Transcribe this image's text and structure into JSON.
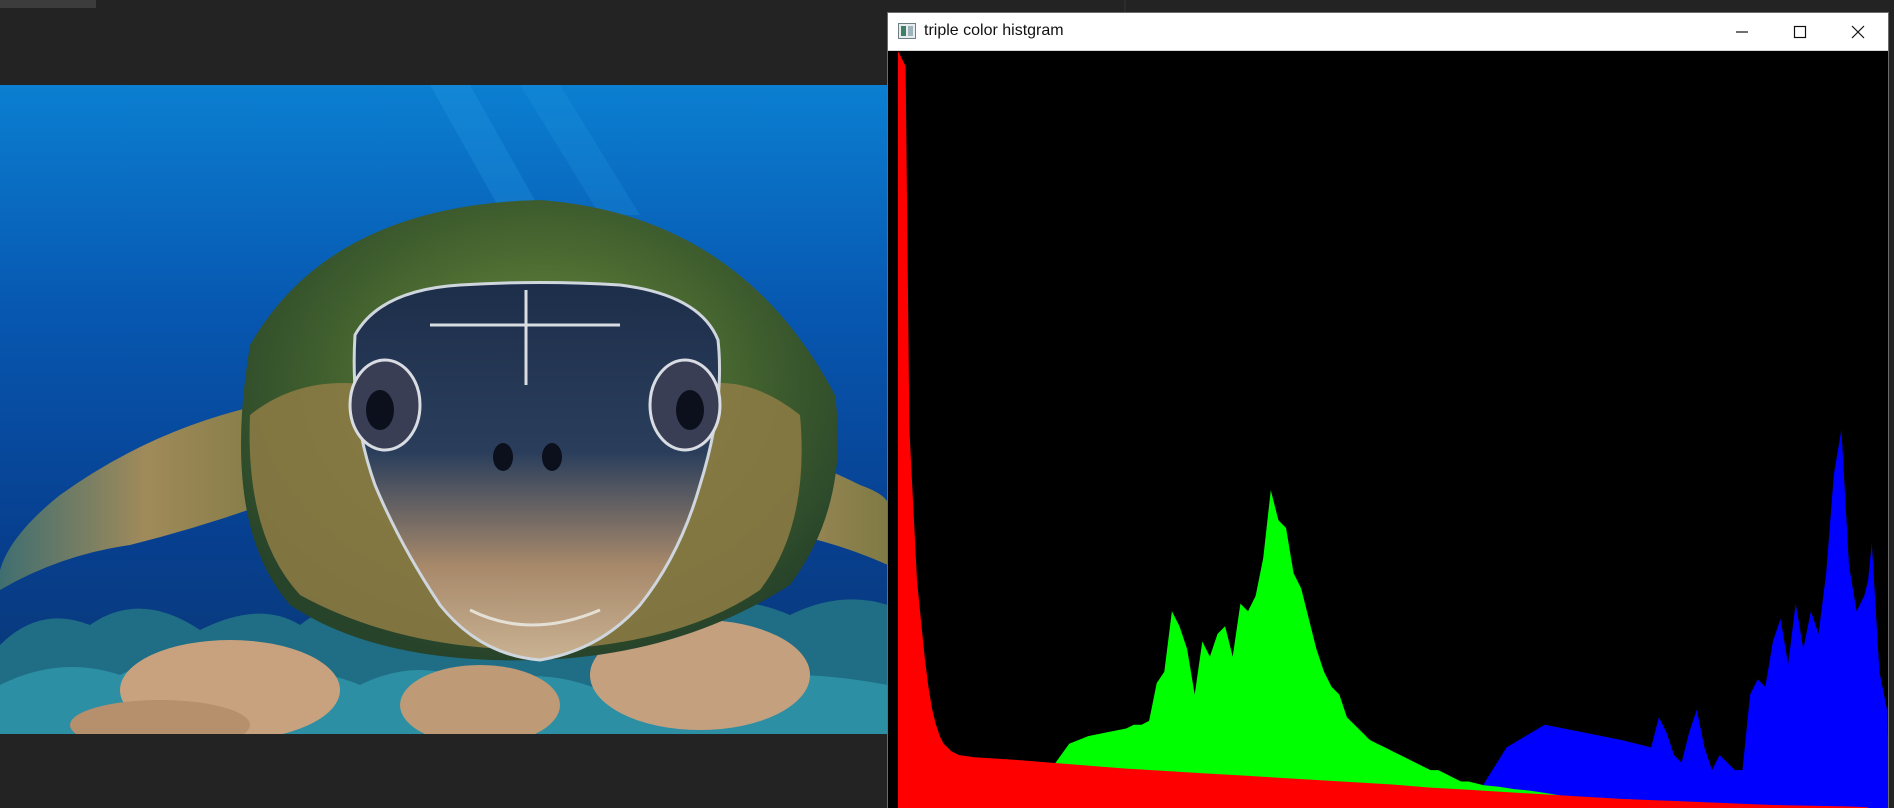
{
  "window": {
    "title": "triple color histgram",
    "icon": "image-window-icon",
    "buttons": [
      "minimize-icon",
      "maximize-icon",
      "close-icon"
    ]
  },
  "photo": {
    "subject": "sea turtle swimming over coral reef",
    "colors": {
      "water_top": "#0b7fd1",
      "water_deep": "#05357e",
      "coral": "#c8a27e"
    }
  },
  "colors": {
    "background": "#232323",
    "red_channel": "#ff0000",
    "green_channel": "#00ff00",
    "blue_channel": "#0000ff",
    "hist_background": "#000000"
  },
  "chart_data": {
    "type": "area",
    "title": "",
    "xlabel": "",
    "ylabel": "",
    "xlim": [
      0,
      255
    ],
    "ylim": [
      0,
      1
    ],
    "grid": false,
    "draw_order": [
      "blue",
      "green",
      "red"
    ],
    "series": [
      {
        "name": "",
        "channel": "blue",
        "color": "#0000ff",
        "points": [
          [
            0,
            0
          ],
          [
            150,
            0
          ],
          [
            160,
            0.08
          ],
          [
            170,
            0.11
          ],
          [
            180,
            0.1
          ],
          [
            190,
            0.09
          ],
          [
            198,
            0.08
          ],
          [
            200,
            0.12
          ],
          [
            202,
            0.1
          ],
          [
            204,
            0.07
          ],
          [
            206,
            0.06
          ],
          [
            208,
            0.1
          ],
          [
            210,
            0.13
          ],
          [
            212,
            0.08
          ],
          [
            214,
            0.05
          ],
          [
            216,
            0.07
          ],
          [
            218,
            0.06
          ],
          [
            220,
            0.05
          ],
          [
            222,
            0.05
          ],
          [
            224,
            0.15
          ],
          [
            226,
            0.17
          ],
          [
            228,
            0.16
          ],
          [
            230,
            0.22
          ],
          [
            232,
            0.25
          ],
          [
            234,
            0.19
          ],
          [
            236,
            0.27
          ],
          [
            238,
            0.21
          ],
          [
            240,
            0.26
          ],
          [
            242,
            0.23
          ],
          [
            244,
            0.31
          ],
          [
            246,
            0.44
          ],
          [
            248,
            0.5
          ],
          [
            250,
            0.32
          ],
          [
            252,
            0.26
          ],
          [
            254,
            0.28
          ],
          [
            255,
            0.3
          ],
          [
            256,
            0.35
          ],
          [
            258,
            0.18
          ],
          [
            260,
            0.13
          ],
          [
            262,
            0.09
          ],
          [
            264,
            0.06
          ],
          [
            266,
            0.05
          ],
          [
            268,
            0.04
          ],
          [
            270,
            0.035
          ],
          [
            272,
            0.025
          ],
          [
            274,
            0.02
          ],
          [
            276,
            0.016
          ],
          [
            278,
            0.014
          ],
          [
            280,
            0.012
          ],
          [
            282,
            0.01
          ],
          [
            284,
            0.009
          ],
          [
            286,
            0.006
          ],
          [
            290,
            0.004
          ],
          [
            300,
            0.002
          ],
          [
            315,
            0
          ]
        ]
      },
      {
        "name": "",
        "channel": "green",
        "color": "#00ff00",
        "points": [
          [
            0,
            0
          ],
          [
            30,
            0
          ],
          [
            35,
            0.03
          ],
          [
            40,
            0.05
          ],
          [
            45,
            0.085
          ],
          [
            50,
            0.095
          ],
          [
            55,
            0.1
          ],
          [
            60,
            0.105
          ],
          [
            62,
            0.11
          ],
          [
            64,
            0.11
          ],
          [
            66,
            0.115
          ],
          [
            68,
            0.165
          ],
          [
            70,
            0.18
          ],
          [
            72,
            0.26
          ],
          [
            74,
            0.24
          ],
          [
            76,
            0.21
          ],
          [
            78,
            0.15
          ],
          [
            80,
            0.22
          ],
          [
            82,
            0.2
          ],
          [
            84,
            0.23
          ],
          [
            86,
            0.24
          ],
          [
            88,
            0.2
          ],
          [
            90,
            0.27
          ],
          [
            92,
            0.26
          ],
          [
            94,
            0.28
          ],
          [
            96,
            0.33
          ],
          [
            98,
            0.42
          ],
          [
            100,
            0.38
          ],
          [
            102,
            0.37
          ],
          [
            104,
            0.31
          ],
          [
            106,
            0.29
          ],
          [
            108,
            0.25
          ],
          [
            110,
            0.21
          ],
          [
            112,
            0.18
          ],
          [
            114,
            0.16
          ],
          [
            116,
            0.15
          ],
          [
            118,
            0.12
          ],
          [
            120,
            0.11
          ],
          [
            122,
            0.1
          ],
          [
            124,
            0.09
          ],
          [
            126,
            0.085
          ],
          [
            128,
            0.08
          ],
          [
            130,
            0.075
          ],
          [
            132,
            0.07
          ],
          [
            134,
            0.065
          ],
          [
            136,
            0.06
          ],
          [
            138,
            0.055
          ],
          [
            140,
            0.05
          ],
          [
            142,
            0.05
          ],
          [
            144,
            0.045
          ],
          [
            146,
            0.04
          ],
          [
            148,
            0.035
          ],
          [
            150,
            0.035
          ],
          [
            154,
            0.03
          ],
          [
            158,
            0.028
          ],
          [
            162,
            0.025
          ],
          [
            166,
            0.023
          ],
          [
            170,
            0.02
          ],
          [
            176,
            0.015
          ],
          [
            182,
            0.012
          ],
          [
            188,
            0.01
          ],
          [
            194,
            0.008
          ],
          [
            200,
            0.006
          ],
          [
            210,
            0.004
          ],
          [
            220,
            0.002
          ],
          [
            230,
            0.001
          ],
          [
            240,
            0
          ]
        ]
      },
      {
        "name": "",
        "channel": "red",
        "color": "#ff0000",
        "points": [
          [
            0,
            1.0
          ],
          [
            1,
            0.99
          ],
          [
            2,
            0.98
          ],
          [
            3,
            0.5
          ],
          [
            4,
            0.4
          ],
          [
            5,
            0.3
          ],
          [
            6,
            0.25
          ],
          [
            7,
            0.2
          ],
          [
            8,
            0.16
          ],
          [
            9,
            0.13
          ],
          [
            10,
            0.11
          ],
          [
            11,
            0.095
          ],
          [
            12,
            0.085
          ],
          [
            13,
            0.08
          ],
          [
            14,
            0.075
          ],
          [
            16,
            0.07
          ],
          [
            20,
            0.067
          ],
          [
            30,
            0.064
          ],
          [
            40,
            0.06
          ],
          [
            50,
            0.056
          ],
          [
            60,
            0.052
          ],
          [
            70,
            0.049
          ],
          [
            80,
            0.046
          ],
          [
            90,
            0.043
          ],
          [
            100,
            0.04
          ],
          [
            110,
            0.037
          ],
          [
            120,
            0.034
          ],
          [
            130,
            0.031
          ],
          [
            140,
            0.027
          ],
          [
            150,
            0.024
          ],
          [
            160,
            0.021
          ],
          [
            170,
            0.018
          ],
          [
            180,
            0.015
          ],
          [
            190,
            0.012
          ],
          [
            200,
            0.01
          ],
          [
            210,
            0.008
          ],
          [
            220,
            0.006
          ],
          [
            230,
            0.004
          ],
          [
            240,
            0.003
          ],
          [
            250,
            0.002
          ],
          [
            255,
            0.001
          ]
        ]
      }
    ]
  }
}
